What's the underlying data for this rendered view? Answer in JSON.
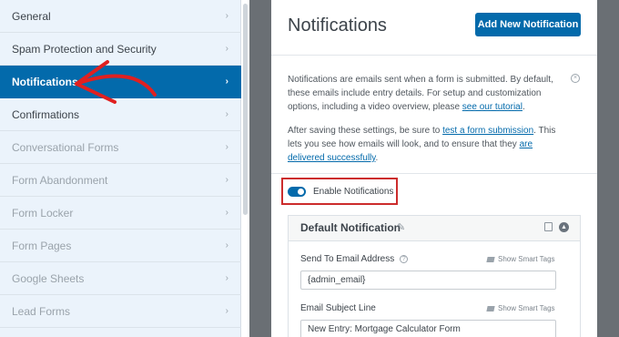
{
  "sidebar": {
    "items": [
      {
        "label": "General",
        "state": "normal"
      },
      {
        "label": "Spam Protection and Security",
        "state": "normal"
      },
      {
        "label": "Notifications",
        "state": "active"
      },
      {
        "label": "Confirmations",
        "state": "normal"
      },
      {
        "label": "Conversational Forms",
        "state": "disabled"
      },
      {
        "label": "Form Abandonment",
        "state": "disabled"
      },
      {
        "label": "Form Locker",
        "state": "disabled"
      },
      {
        "label": "Form Pages",
        "state": "disabled"
      },
      {
        "label": "Google Sheets",
        "state": "disabled"
      },
      {
        "label": "Lead Forms",
        "state": "disabled"
      }
    ],
    "chevron": "›"
  },
  "main": {
    "title": "Notifications",
    "add_button": "Add New Notification",
    "intro": {
      "text": "Notifications are emails sent when a form is submitted. By default, these emails include entry details. For setup and customization options, including a video overview, please ",
      "link": "see our tutorial",
      "end": "."
    },
    "intro2": {
      "a": "After saving these settings, be sure to ",
      "link1": "test a form submission",
      "b": ". This lets you see how emails will look, and to ensure that they ",
      "link2": "are delivered successfully",
      "c": "."
    },
    "toggle": {
      "label": "Enable Notifications",
      "enabled": true
    },
    "default_notification": {
      "title": "Default Notification",
      "fields": [
        {
          "label": "Send To Email Address",
          "value": "{admin_email}",
          "smart_tags": "Show Smart Tags"
        },
        {
          "label": "Email Subject Line",
          "value": "New Entry: Mortgage Calculator Form",
          "smart_tags": "Show Smart Tags"
        }
      ]
    }
  },
  "colors": {
    "accent": "#036aab",
    "highlight_border": "#cc2c2c",
    "annotation_arrow": "#e02020"
  }
}
